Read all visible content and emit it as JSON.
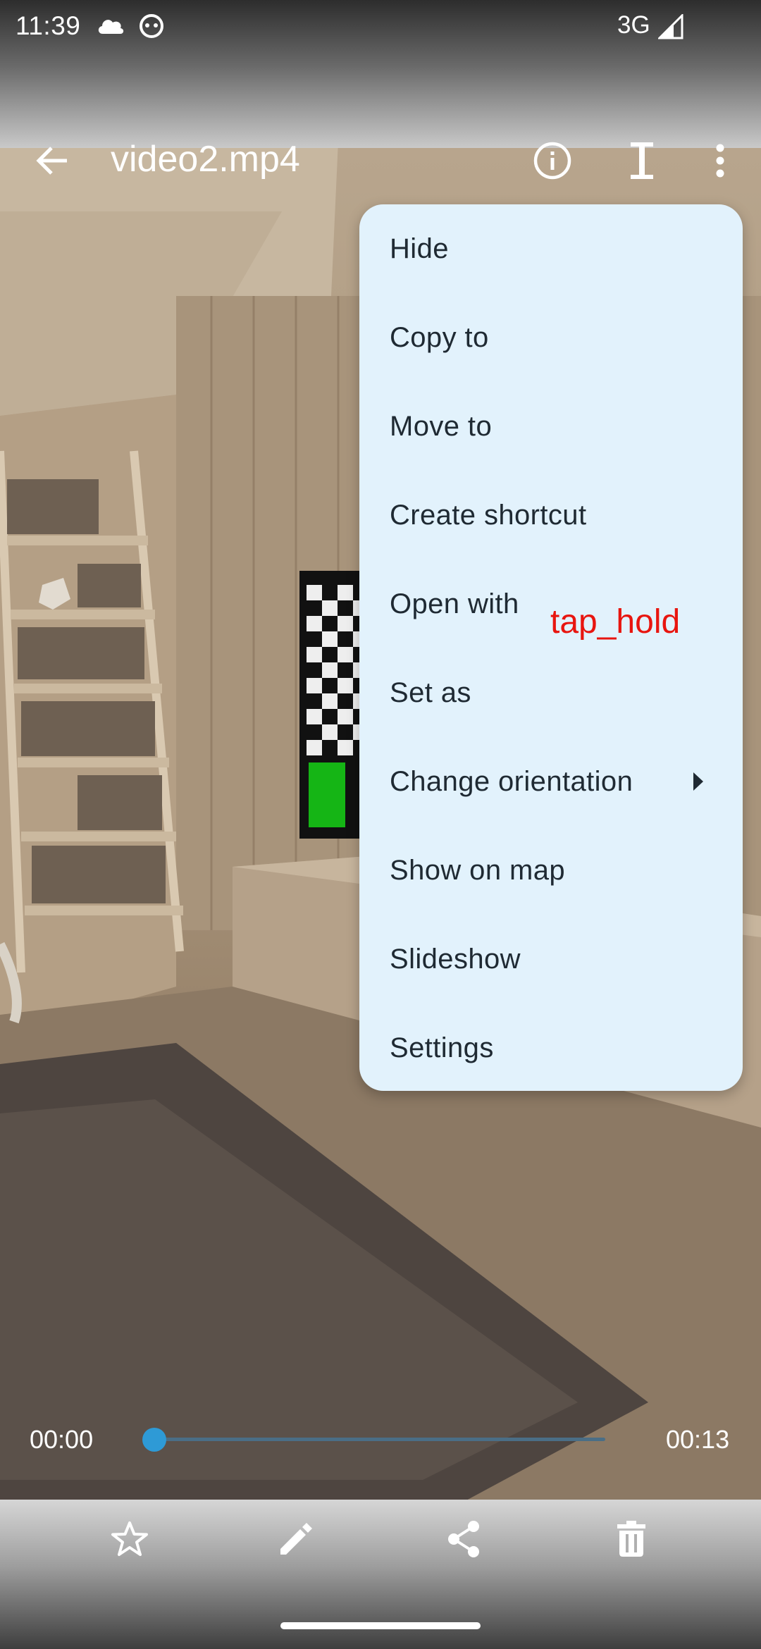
{
  "status_bar": {
    "time": "11:39",
    "network": "3G",
    "icons": [
      "cloud-icon",
      "android-face-icon",
      "signal-icon"
    ]
  },
  "app_bar": {
    "title": "video2.mp4",
    "icons": [
      "back-arrow-icon",
      "info-icon",
      "text-cursor-icon",
      "more-vert-icon"
    ]
  },
  "menu": {
    "items": [
      {
        "label": "Hide"
      },
      {
        "label": "Copy to"
      },
      {
        "label": "Move to"
      },
      {
        "label": "Create shortcut"
      },
      {
        "label": "Open with"
      },
      {
        "label": "Set as"
      },
      {
        "label": "Change orientation",
        "has_submenu": true
      },
      {
        "label": "Show on map"
      },
      {
        "label": "Slideshow"
      },
      {
        "label": "Settings"
      }
    ]
  },
  "action_annotation": {
    "text": "tap_hold",
    "color": "#e8150f"
  },
  "player": {
    "current_time": "00:00",
    "duration": "00:13",
    "progress_fraction": 0,
    "accent_color": "#2e9ad6"
  },
  "bottom_bar": {
    "icons": [
      "star-outline-icon",
      "edit-pencil-icon",
      "share-icon",
      "delete-icon"
    ]
  },
  "colors": {
    "menu_background": "#e2f2fc",
    "menu_text": "#1f2a33"
  }
}
